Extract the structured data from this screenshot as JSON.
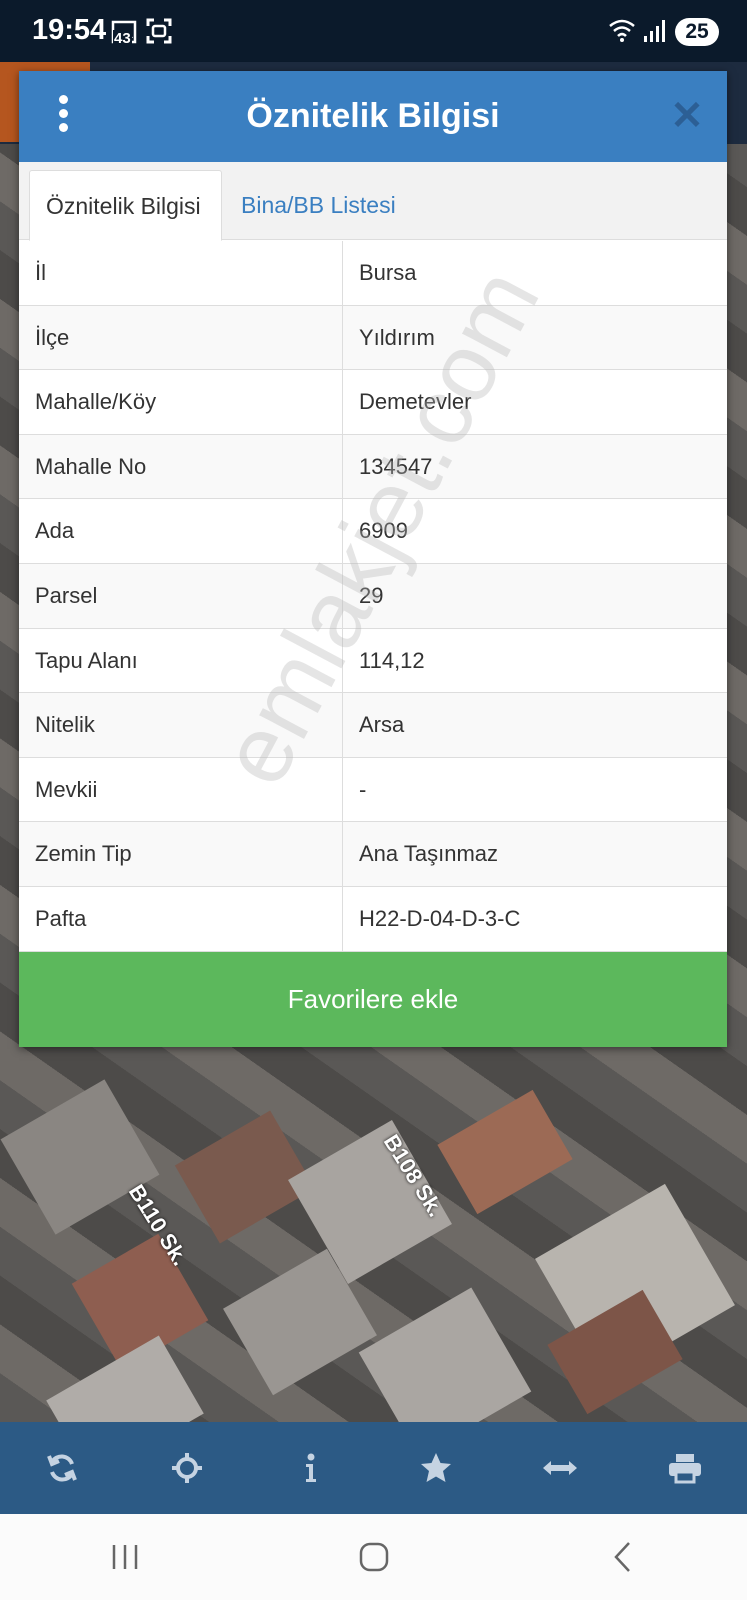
{
  "status_bar": {
    "time": "19:54",
    "notification_badge": "43",
    "battery": "25",
    "icons": [
      "gallery-icon",
      "screenshot-icon",
      "wifi-icon",
      "signal-icon"
    ]
  },
  "modal": {
    "title": "Öznitelik Bilgisi",
    "tabs": [
      {
        "label": "Öznitelik Bilgisi",
        "active": true
      },
      {
        "label": "Bina/BB Listesi",
        "active": false
      }
    ],
    "rows": [
      {
        "label": "İl",
        "value": "Bursa"
      },
      {
        "label": "İlçe",
        "value": "Yıldırım"
      },
      {
        "label": "Mahalle/Köy",
        "value": "Demetevler"
      },
      {
        "label": "Mahalle No",
        "value": "134547"
      },
      {
        "label": "Ada",
        "value": "6909"
      },
      {
        "label": "Parsel",
        "value": "29"
      },
      {
        "label": "Tapu Alanı",
        "value": "114,12"
      },
      {
        "label": "Nitelik",
        "value": "Arsa"
      },
      {
        "label": "Mevkii",
        "value": "-"
      },
      {
        "label": "Zemin Tip",
        "value": "Ana Taşınmaz"
      },
      {
        "label": "Pafta",
        "value": "H22-D-04-D-3-C"
      }
    ],
    "favorite_button": "Favorilere ekle"
  },
  "watermark": "emlakjet.com",
  "map": {
    "street_labels": [
      "B110 Sk.",
      "B108 Sk."
    ]
  },
  "toolbar": {
    "icons": [
      "refresh-icon",
      "crosshair-icon",
      "info-icon",
      "star-icon",
      "measure-icon",
      "print-icon"
    ]
  },
  "colors": {
    "header_blue": "#3a7fc1",
    "favorite_green": "#5cb85c",
    "toolbar_blue": "#2c5a85"
  }
}
